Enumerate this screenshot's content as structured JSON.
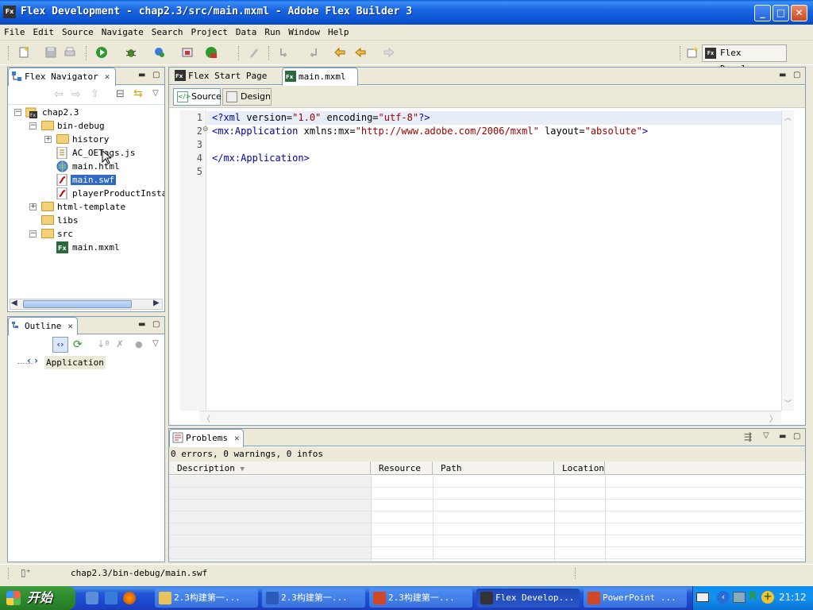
{
  "window": {
    "title": "Flex Development - chap2.3/src/main.mxml - Adobe Flex Builder 3",
    "app_icon": "Fx"
  },
  "menu": [
    "File",
    "Edit",
    "Source",
    "Navigate",
    "Search",
    "Project",
    "Data",
    "Run",
    "Window",
    "Help"
  ],
  "perspective": {
    "label": "Flex Devel...",
    "icon": "Fx"
  },
  "navigator": {
    "tab_label": "Flex Navigator",
    "tree": [
      {
        "label": "chap2.3",
        "level": 0,
        "expanded": true,
        "icon": "project-icon"
      },
      {
        "label": "bin-debug",
        "level": 1,
        "expanded": true,
        "icon": "folder-icon"
      },
      {
        "label": "history",
        "level": 2,
        "expanded": false,
        "icon": "folder-icon"
      },
      {
        "label": "AC_OETags.js",
        "level": 2,
        "icon": "js-file-icon"
      },
      {
        "label": "main.html",
        "level": 2,
        "icon": "html-file-icon"
      },
      {
        "label": "main.swf",
        "level": 2,
        "icon": "swf-file-icon",
        "selected": true
      },
      {
        "label": "playerProductInstal",
        "level": 2,
        "icon": "swf-file-icon"
      },
      {
        "label": "html-template",
        "level": 1,
        "expanded": false,
        "icon": "folder-icon"
      },
      {
        "label": "libs",
        "level": 1,
        "icon": "folder-icon"
      },
      {
        "label": "src",
        "level": 1,
        "expanded": true,
        "icon": "folder-icon"
      },
      {
        "label": "main.mxml",
        "level": 2,
        "icon": "mxml-file-icon"
      }
    ]
  },
  "outline": {
    "tab_label": "Outline",
    "root": "Application"
  },
  "editor": {
    "tabs": [
      "Flex Start Page",
      "main.mxml"
    ],
    "active_tab": "main.mxml",
    "mode_source": "Source",
    "mode_design": "Design",
    "lines": [
      {
        "num": "1",
        "text": "<?xml version=\"1.0\" encoding=\"utf-8\"?>"
      },
      {
        "num": "2",
        "text": "<mx:Application xmlns:mx=\"http://www.adobe.com/2006/mxml\" layout=\"absolute\">"
      },
      {
        "num": "3",
        "text": ""
      },
      {
        "num": "4",
        "text": "</mx:Application>"
      },
      {
        "num": "5",
        "text": ""
      }
    ]
  },
  "problems": {
    "tab_label": "Problems",
    "summary": "0 errors, 0 warnings, 0 infos",
    "columns": [
      "Description",
      "Resource",
      "Path",
      "Location"
    ]
  },
  "status": {
    "path": "chap2.3/bin-debug/main.swf"
  },
  "taskbar": {
    "start_label": "开始",
    "tasks": [
      {
        "label": "2.3构建第一...",
        "icon": "folder-icon",
        "color": "#e8c35c"
      },
      {
        "label": "2.3构建第一...",
        "icon": "word-icon",
        "color": "#2b5bb8"
      },
      {
        "label": "2.3构建第一...",
        "icon": "powerpoint-icon",
        "color": "#d24726"
      },
      {
        "label": "Flex Develop...",
        "icon": "flex-icon",
        "color": "#333333",
        "active": true
      },
      {
        "label": "PowerPoint ...",
        "icon": "powerpoint-icon",
        "color": "#d24726"
      }
    ],
    "clock": "21:12"
  }
}
